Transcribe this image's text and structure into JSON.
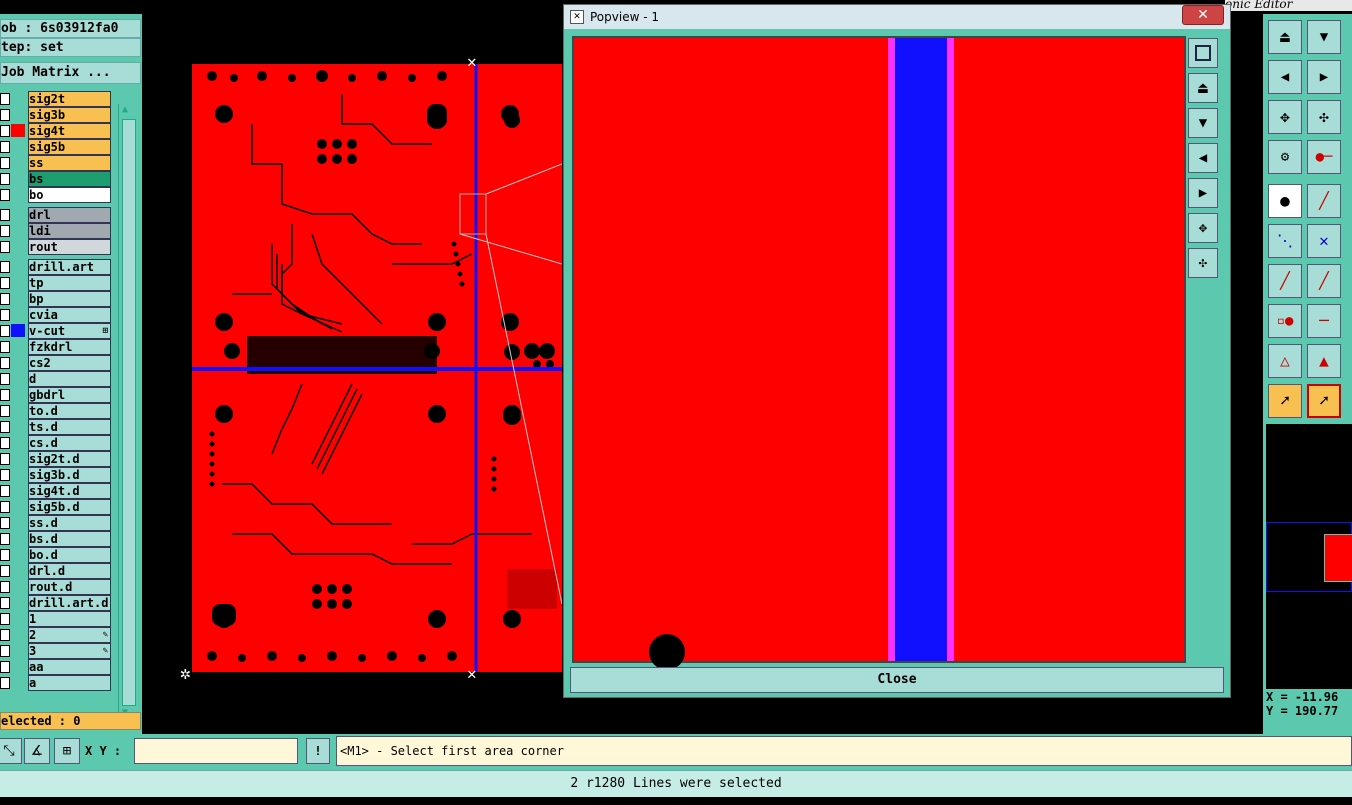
{
  "left_panel": {
    "job": "ob : 6s03912fa0",
    "step": "tep: set",
    "job_matrix": "Job Matrix ...",
    "selected": "elected : 0",
    "layers": [
      {
        "name": "sig2t",
        "bg": "#f8c050",
        "color": ""
      },
      {
        "name": "sig3b",
        "bg": "#f8c050",
        "color": ""
      },
      {
        "name": "sig4t",
        "bg": "#f8c050",
        "color": "#ff0000"
      },
      {
        "name": "sig5b",
        "bg": "#f8c050",
        "color": ""
      },
      {
        "name": "ss",
        "bg": "#f8c050",
        "color": ""
      },
      {
        "name": "bs",
        "bg": "#1e9e6e",
        "color": ""
      },
      {
        "name": "bo",
        "bg": "#ffffff",
        "color": ""
      },
      {
        "name": "drl",
        "bg": "#a0a8b0",
        "color": ""
      },
      {
        "name": "ldi",
        "bg": "#a0a8b0",
        "color": ""
      },
      {
        "name": "rout",
        "bg": "#d0d8dc",
        "color": ""
      },
      {
        "name": "drill.art",
        "bg": "#a8dcd6",
        "color": ""
      },
      {
        "name": "tp",
        "bg": "#a8dcd6",
        "color": ""
      },
      {
        "name": "bp",
        "bg": "#a8dcd6",
        "color": ""
      },
      {
        "name": "cvia",
        "bg": "#a8dcd6",
        "color": ""
      },
      {
        "name": "v-cut",
        "bg": "#a8dcd6",
        "color": "#1010ff",
        "mark": "⊞"
      },
      {
        "name": "fzkdrl",
        "bg": "#a8dcd6",
        "color": ""
      },
      {
        "name": "cs2",
        "bg": "#a8dcd6",
        "color": ""
      },
      {
        "name": "d",
        "bg": "#a8dcd6",
        "color": ""
      },
      {
        "name": "gbdrl",
        "bg": "#a8dcd6",
        "color": ""
      },
      {
        "name": "to.d",
        "bg": "#a8dcd6",
        "color": ""
      },
      {
        "name": "ts.d",
        "bg": "#a8dcd6",
        "color": ""
      },
      {
        "name": "cs.d",
        "bg": "#a8dcd6",
        "color": ""
      },
      {
        "name": "sig2t.d",
        "bg": "#a8dcd6",
        "color": ""
      },
      {
        "name": "sig3b.d",
        "bg": "#a8dcd6",
        "color": ""
      },
      {
        "name": "sig4t.d",
        "bg": "#a8dcd6",
        "color": ""
      },
      {
        "name": "sig5b.d",
        "bg": "#a8dcd6",
        "color": ""
      },
      {
        "name": "ss.d",
        "bg": "#a8dcd6",
        "color": ""
      },
      {
        "name": "bs.d",
        "bg": "#a8dcd6",
        "color": ""
      },
      {
        "name": "bo.d",
        "bg": "#a8dcd6",
        "color": ""
      },
      {
        "name": "drl.d",
        "bg": "#a8dcd6",
        "color": ""
      },
      {
        "name": "rout.d",
        "bg": "#a8dcd6",
        "color": ""
      },
      {
        "name": "drill.art.d",
        "bg": "#a8dcd6",
        "color": ""
      },
      {
        "name": "1",
        "bg": "#a8dcd6",
        "color": ""
      },
      {
        "name": "2",
        "bg": "#a8dcd6",
        "color": "",
        "mark": "✎"
      },
      {
        "name": "3",
        "bg": "#a8dcd6",
        "color": "",
        "mark": "✎"
      },
      {
        "name": "aa",
        "bg": "#a8dcd6",
        "color": ""
      },
      {
        "name": "a",
        "bg": "#a8dcd6",
        "color": ""
      }
    ]
  },
  "popview": {
    "title": "Popview - 1",
    "close_x": "✕",
    "close_label": "Close"
  },
  "window_title_fragment": "onic Editor",
  "bottom": {
    "xy_label": "X Y :",
    "xy_value": "",
    "exclaim": "!",
    "prompt": "<M1> - Select first area corner",
    "status": "2 r1280 Lines were selected"
  },
  "coords": {
    "x": "X = -11.96",
    "y": "Y = 190.77"
  },
  "colors": {
    "board_red": "#ff0000",
    "vcut_blue": "#1010ff",
    "highlight_magenta": "#ff30ff",
    "panel_teal": "#5cc8ad"
  }
}
